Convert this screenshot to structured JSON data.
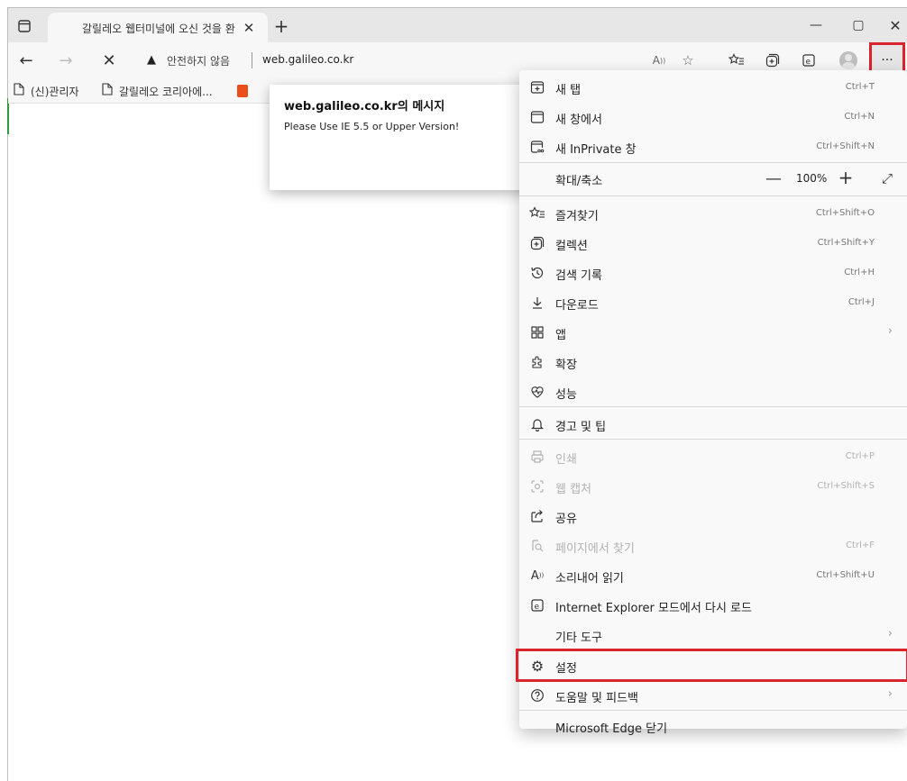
{
  "tab": {
    "title": "갈릴레오 웹터미널에 오신 것을 환",
    "close": "✕",
    "new": "+"
  },
  "window": {
    "minimize": "—",
    "maximize": "▢",
    "close": "✕"
  },
  "toolbar": {
    "back": "←",
    "forward": "→",
    "stop": "✕",
    "insecure_label": "안전하지 않음",
    "url": "web.galileo.co.kr",
    "menu_label": "···"
  },
  "favorites": [
    {
      "label": "(신)관리자",
      "icon": "page-icon"
    },
    {
      "label": "갈릴레오 코리아에...",
      "icon": "page-icon"
    },
    {
      "label": "",
      "icon": "office-icon"
    }
  ],
  "dialog": {
    "title": "web.galileo.co.kr의 메시지",
    "message": "Please Use IE 5.5 or Upper Version!"
  },
  "menu": {
    "new_tab": {
      "label": "새 탭",
      "shortcut": "Ctrl+T"
    },
    "new_window": {
      "label": "새 창에서",
      "shortcut": "Ctrl+N"
    },
    "new_inprivate": {
      "label": "새 InPrivate 창",
      "shortcut": "Ctrl+Shift+N"
    },
    "zoom": {
      "label": "확대/축소",
      "minus": "—",
      "value": "100%",
      "plus": "+"
    },
    "favorites": {
      "label": "즐겨찾기",
      "shortcut": "Ctrl+Shift+O"
    },
    "collections": {
      "label": "컬렉션",
      "shortcut": "Ctrl+Shift+Y"
    },
    "history": {
      "label": "검색 기록",
      "shortcut": "Ctrl+H"
    },
    "downloads": {
      "label": "다운로드",
      "shortcut": "Ctrl+J"
    },
    "apps": {
      "label": "앱"
    },
    "extensions": {
      "label": "확장"
    },
    "performance": {
      "label": "성능"
    },
    "alerts": {
      "label": "경고 및 팁"
    },
    "print": {
      "label": "인쇄",
      "shortcut": "Ctrl+P"
    },
    "web_capture": {
      "label": "웹 캡처",
      "shortcut": "Ctrl+Shift+S"
    },
    "share": {
      "label": "공유"
    },
    "find": {
      "label": "페이지에서 찾기",
      "shortcut": "Ctrl+F"
    },
    "read_aloud": {
      "label": "소리내어 읽기",
      "shortcut": "Ctrl+Shift+U"
    },
    "ie_mode": {
      "label": "Internet Explorer 모드에서 다시 로드"
    },
    "more_tools": {
      "label": "기타 도구"
    },
    "settings": {
      "label": "설정"
    },
    "help": {
      "label": "도움말 및 피드백"
    },
    "close_edge": {
      "label": "Microsoft Edge 닫기"
    }
  },
  "accent_colors": {
    "highlight": "#d9232d",
    "office": "#e94e1b"
  }
}
